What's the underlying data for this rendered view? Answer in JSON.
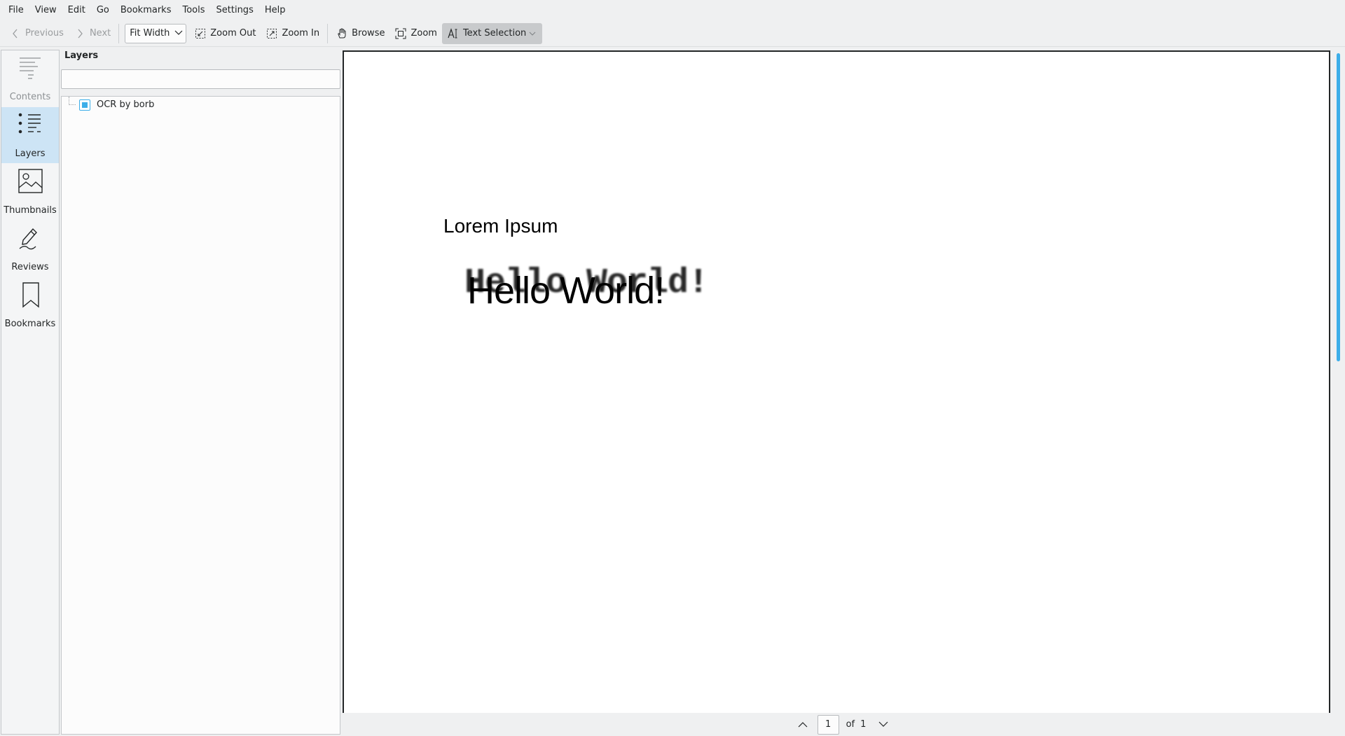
{
  "menubar": {
    "items": [
      "File",
      "View",
      "Edit",
      "Go",
      "Bookmarks",
      "Tools",
      "Settings",
      "Help"
    ]
  },
  "toolbar": {
    "previous_label": "Previous",
    "next_label": "Next",
    "zoom_mode_value": "Fit Width",
    "zoom_out_label": "Zoom Out",
    "zoom_in_label": "Zoom In",
    "browse_label": "Browse",
    "zoom_label": "Zoom",
    "text_selection_label": "Text Selection"
  },
  "sidebar": {
    "tabs": [
      {
        "label": "Contents",
        "icon": "contents-icon",
        "state": "disabled"
      },
      {
        "label": "Layers",
        "icon": "layers-icon",
        "state": "selected"
      },
      {
        "label": "Thumbnails",
        "icon": "thumbnails-icon",
        "state": "normal"
      },
      {
        "label": "Reviews",
        "icon": "reviews-icon",
        "state": "normal"
      },
      {
        "label": "Bookmarks",
        "icon": "bookmarks-icon",
        "state": "normal"
      }
    ]
  },
  "layers_panel": {
    "title": "Layers",
    "search_value": "",
    "items": [
      {
        "label": "OCR by borb",
        "checked": true
      }
    ]
  },
  "document": {
    "heading": "Lorem Ipsum",
    "ocr_text": "Hello World!",
    "scanned_text": "Hello World!"
  },
  "pagenav": {
    "current_page": "1",
    "of_label": "of",
    "total_pages": "1"
  },
  "colors": {
    "accent": "#3daee9",
    "selected_tab": "#cde4f5",
    "window_bg": "#eff0f1"
  }
}
